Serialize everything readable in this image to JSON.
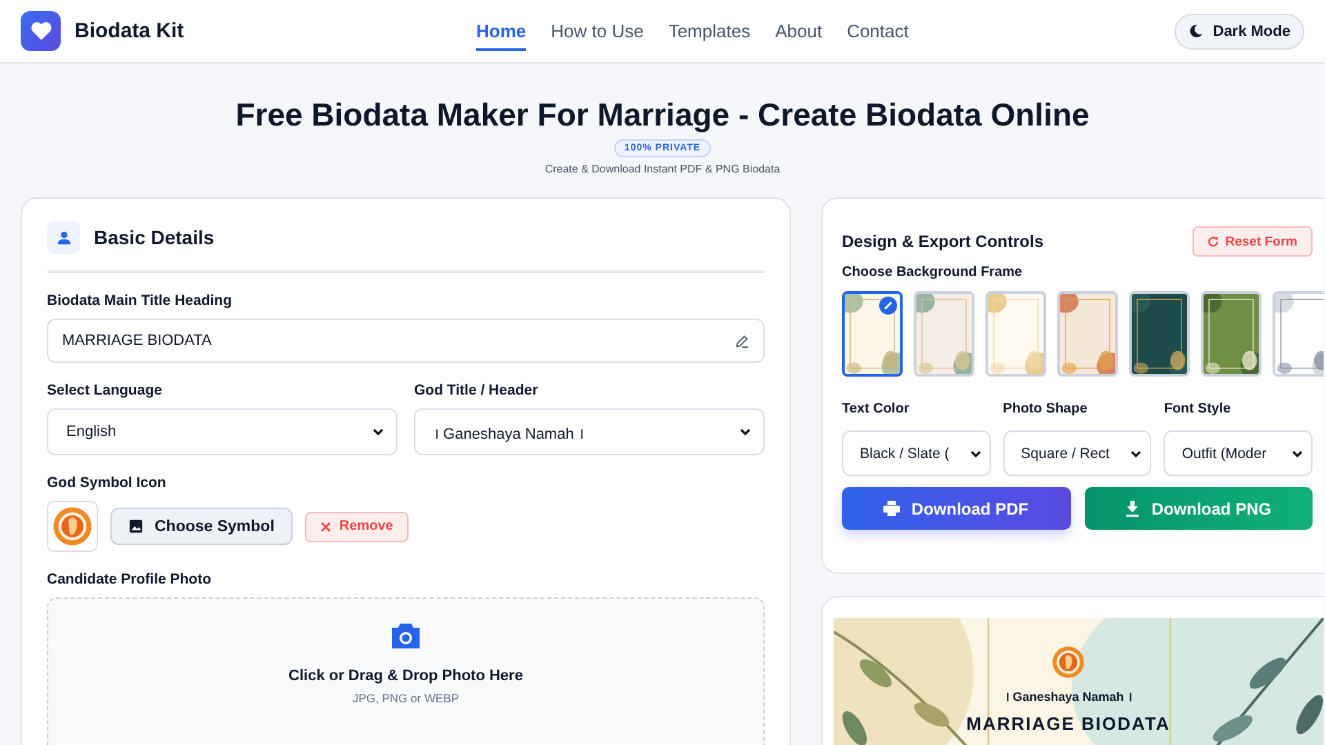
{
  "header": {
    "brand": "Biodata Kit",
    "nav": [
      {
        "label": "Home",
        "selected": true
      },
      {
        "label": "How to Use",
        "selected": false
      },
      {
        "label": "Templates",
        "selected": false
      },
      {
        "label": "About",
        "selected": false
      },
      {
        "label": "Contact",
        "selected": false
      }
    ],
    "theme_button": "Dark Mode"
  },
  "hero": {
    "title": "Free Biodata Maker For Marriage - Create Biodata Online",
    "badge": "100% PRIVATE",
    "subtitle": "Create & Download Instant PDF & PNG Biodata"
  },
  "basic_details": {
    "title": "Basic Details",
    "main_title": {
      "label": "Biodata Main Title Heading",
      "value": "MARRIAGE BIODATA"
    },
    "language": {
      "label": "Select Language",
      "value": "English"
    },
    "god_title": {
      "label": "God Title / Header",
      "value": "। Ganeshaya Namah ।"
    },
    "god_symbol": {
      "label": "God Symbol Icon",
      "choose_button": "Choose Symbol",
      "remove_button": "Remove"
    },
    "photo": {
      "label": "Candidate Profile Photo",
      "prompt": "Click or Drag & Drop Photo Here",
      "hint": "JPG, PNG or WEBP"
    }
  },
  "design": {
    "title": "Design & Export Controls",
    "reset_button": "Reset Form",
    "frames_label": "Choose Background Frame",
    "frames": [
      {
        "selected": true
      },
      {
        "selected": false
      },
      {
        "selected": false
      },
      {
        "selected": false
      },
      {
        "selected": false
      },
      {
        "selected": false
      },
      {
        "selected": false
      }
    ],
    "selects": [
      {
        "label": "Text Color",
        "value": "Black / Slate ("
      },
      {
        "label": "Photo Shape",
        "value": "Square / Rect"
      },
      {
        "label": "Font Style",
        "value": "Outfit (Moder"
      }
    ],
    "pdf_button": "Download PDF",
    "png_button": "Download PNG"
  },
  "preview": {
    "god_title": "। Ganeshaya Namah ।",
    "title": "MARRIAGE BIODATA"
  }
}
